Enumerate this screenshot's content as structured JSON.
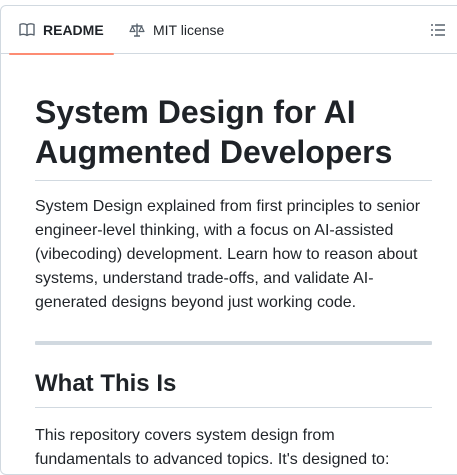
{
  "tabs": {
    "readme_label": "README",
    "license_label": "MIT license",
    "active_accent": "#fd8c73"
  },
  "icons": {
    "readme": "book-icon",
    "license": "law-scale-icon",
    "outline": "list-unordered-icon"
  },
  "article": {
    "title": "System Design for AI Augmented Developers",
    "intro": "System Design explained from first principles to senior engineer-level thinking, with a focus on AI-assisted (vibecoding) development. Learn how to reason about systems, understand trade-offs, and validate AI-generated designs beyond just working code.",
    "section_heading": "What This Is",
    "section_text": "This repository covers system design from fundamentals to advanced topics. It's designed to:"
  }
}
